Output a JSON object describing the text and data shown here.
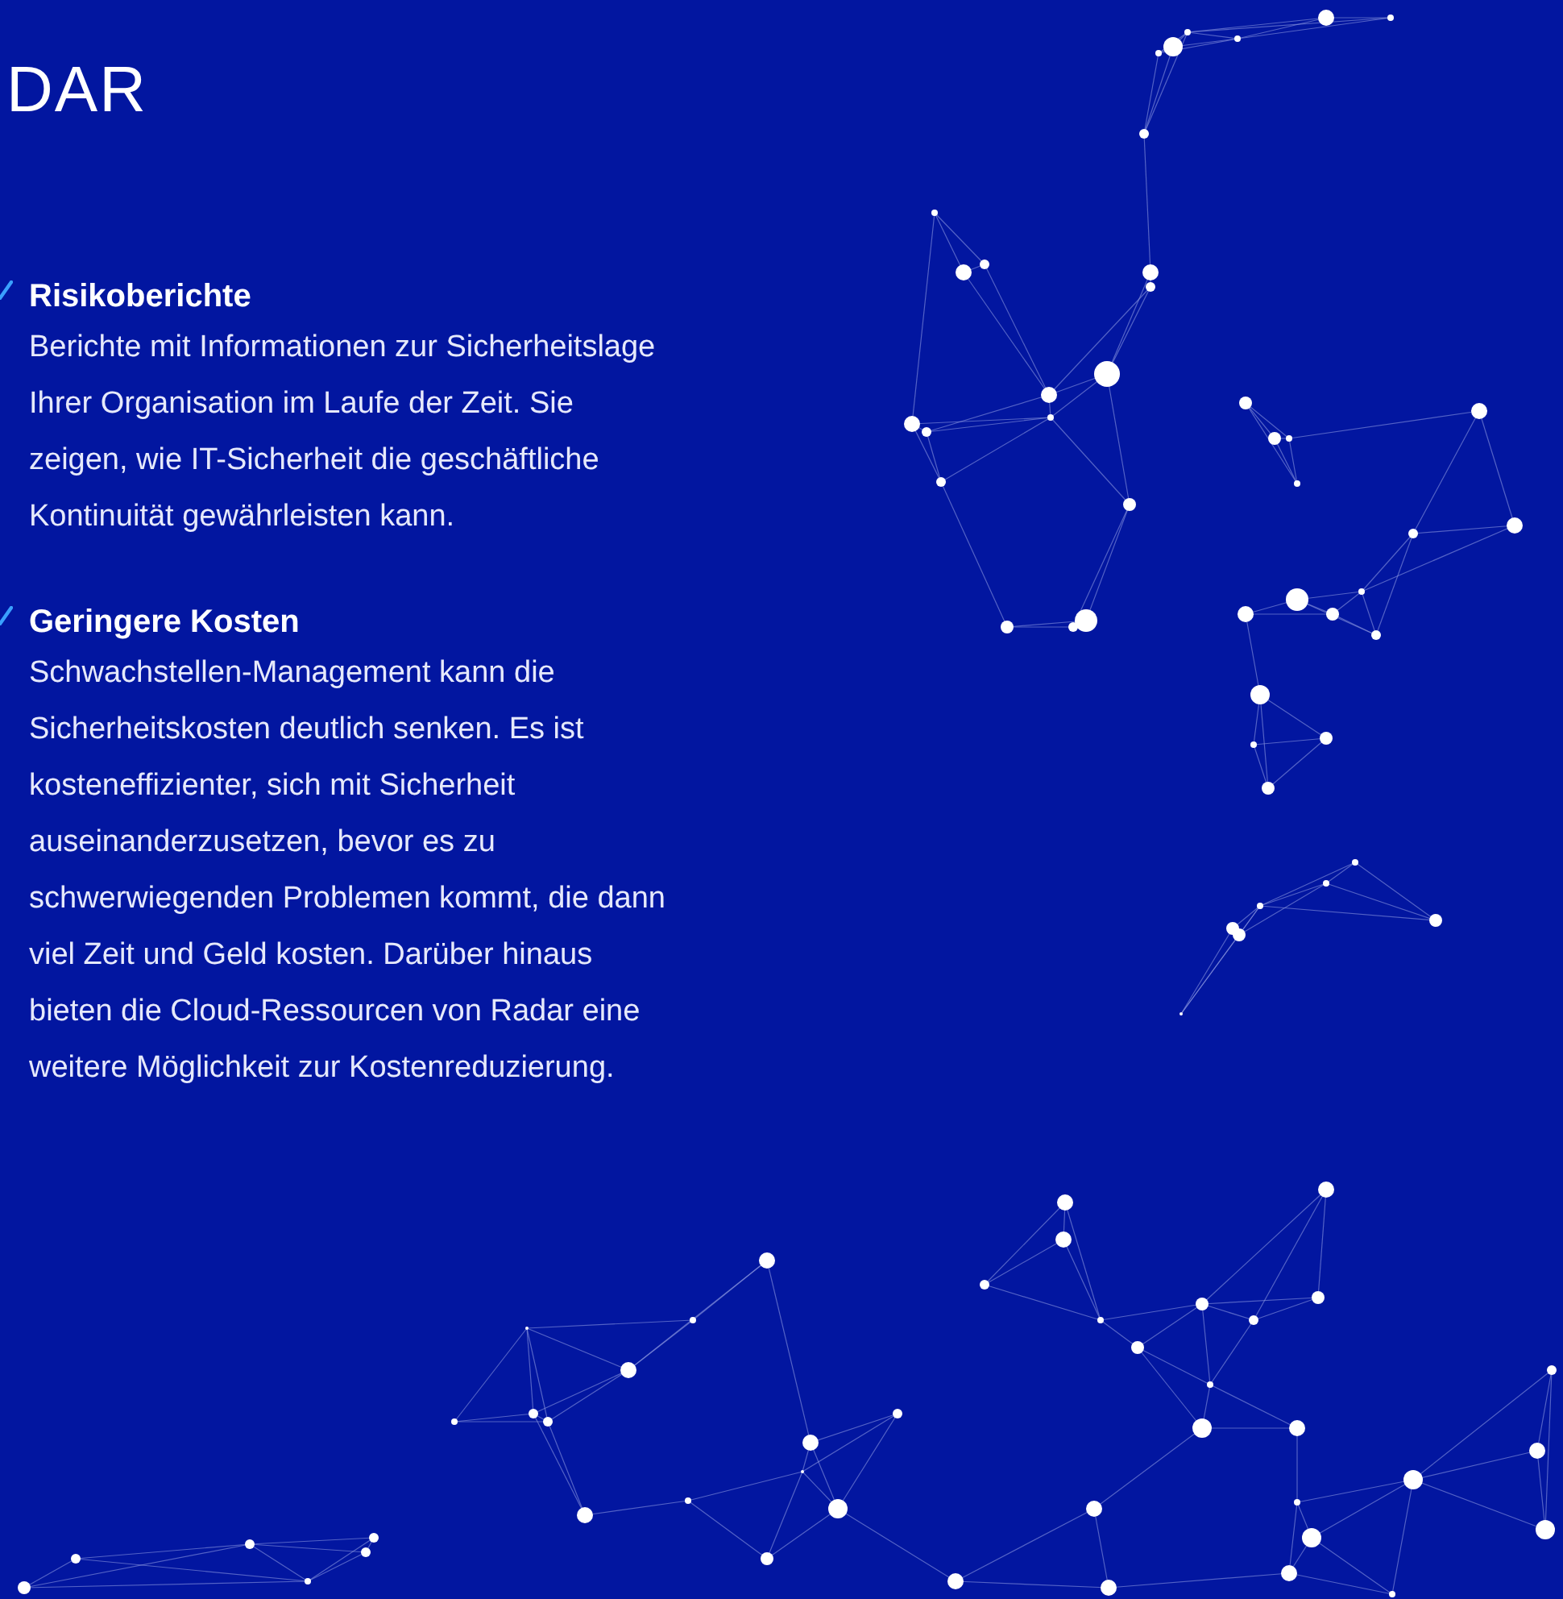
{
  "heading": "DAR",
  "features": [
    {
      "title": "Risikoberichte",
      "text": "Berichte mit Informationen zur Sicherheitslage Ihrer Organisation im Laufe der Zeit. Sie zeigen, wie IT-Sicherheit die geschäftliche Kontinuität gewährleisten kann."
    },
    {
      "title": "Geringere Kosten",
      "text": "Schwachstellen-Management kann die Sicherheitskosten deutlich senken. Es ist kosteneffizienter, sich mit Sicherheit auseinanderzusetzen, bevor es zu schwerwiegenden Problemen kommt, die dann viel Zeit und Geld kosten. Darüber hinaus bieten die Cloud-Ressourcen von Radar eine weitere Möglichkeit zur Kostenreduzierung."
    }
  ]
}
